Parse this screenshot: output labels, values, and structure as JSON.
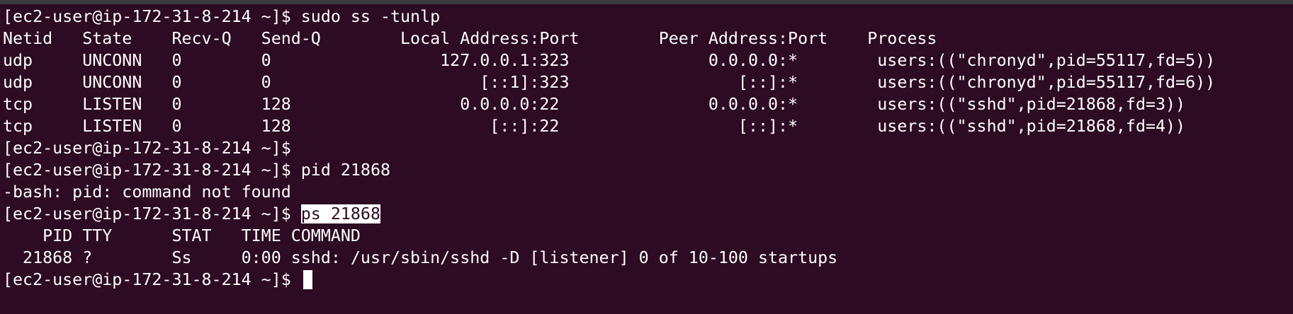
{
  "colors": {
    "background": "#2c0b23",
    "foreground": "#ffffff",
    "selection_bg": "#ffffff"
  },
  "terminal": {
    "prompt": "[ec2-user@ip-172-31-8-214 ~]$ ",
    "lines": [
      "[ec2-user@ip-172-31-8-214 ~]$ sudo ss -tunlp",
      "Netid   State    Recv-Q   Send-Q        Local Address:Port        Peer Address:Port    Process",
      "udp     UNCONN   0        0                 127.0.0.1:323              0.0.0.0:*        users:((\"chronyd\",pid=55117,fd=5))",
      "udp     UNCONN   0        0                     [::1]:323                 [::]:*        users:((\"chronyd\",pid=55117,fd=6))",
      "tcp     LISTEN   0        128                 0.0.0.0:22               0.0.0.0:*        users:((\"sshd\",pid=21868,fd=3))",
      "tcp     LISTEN   0        128                    [::]:22                  [::]:*        users:((\"sshd\",pid=21868,fd=4))",
      "[ec2-user@ip-172-31-8-214 ~]$ ",
      "[ec2-user@ip-172-31-8-214 ~]$ pid 21868",
      "-bash: pid: command not found"
    ],
    "selected_command": "ps 21868",
    "ps_lines": [
      "    PID TTY      STAT   TIME COMMAND",
      "  21868 ?        Ss     0:00 sshd: /usr/sbin/sshd -D [listener] 0 of 10-100 startups"
    ]
  }
}
